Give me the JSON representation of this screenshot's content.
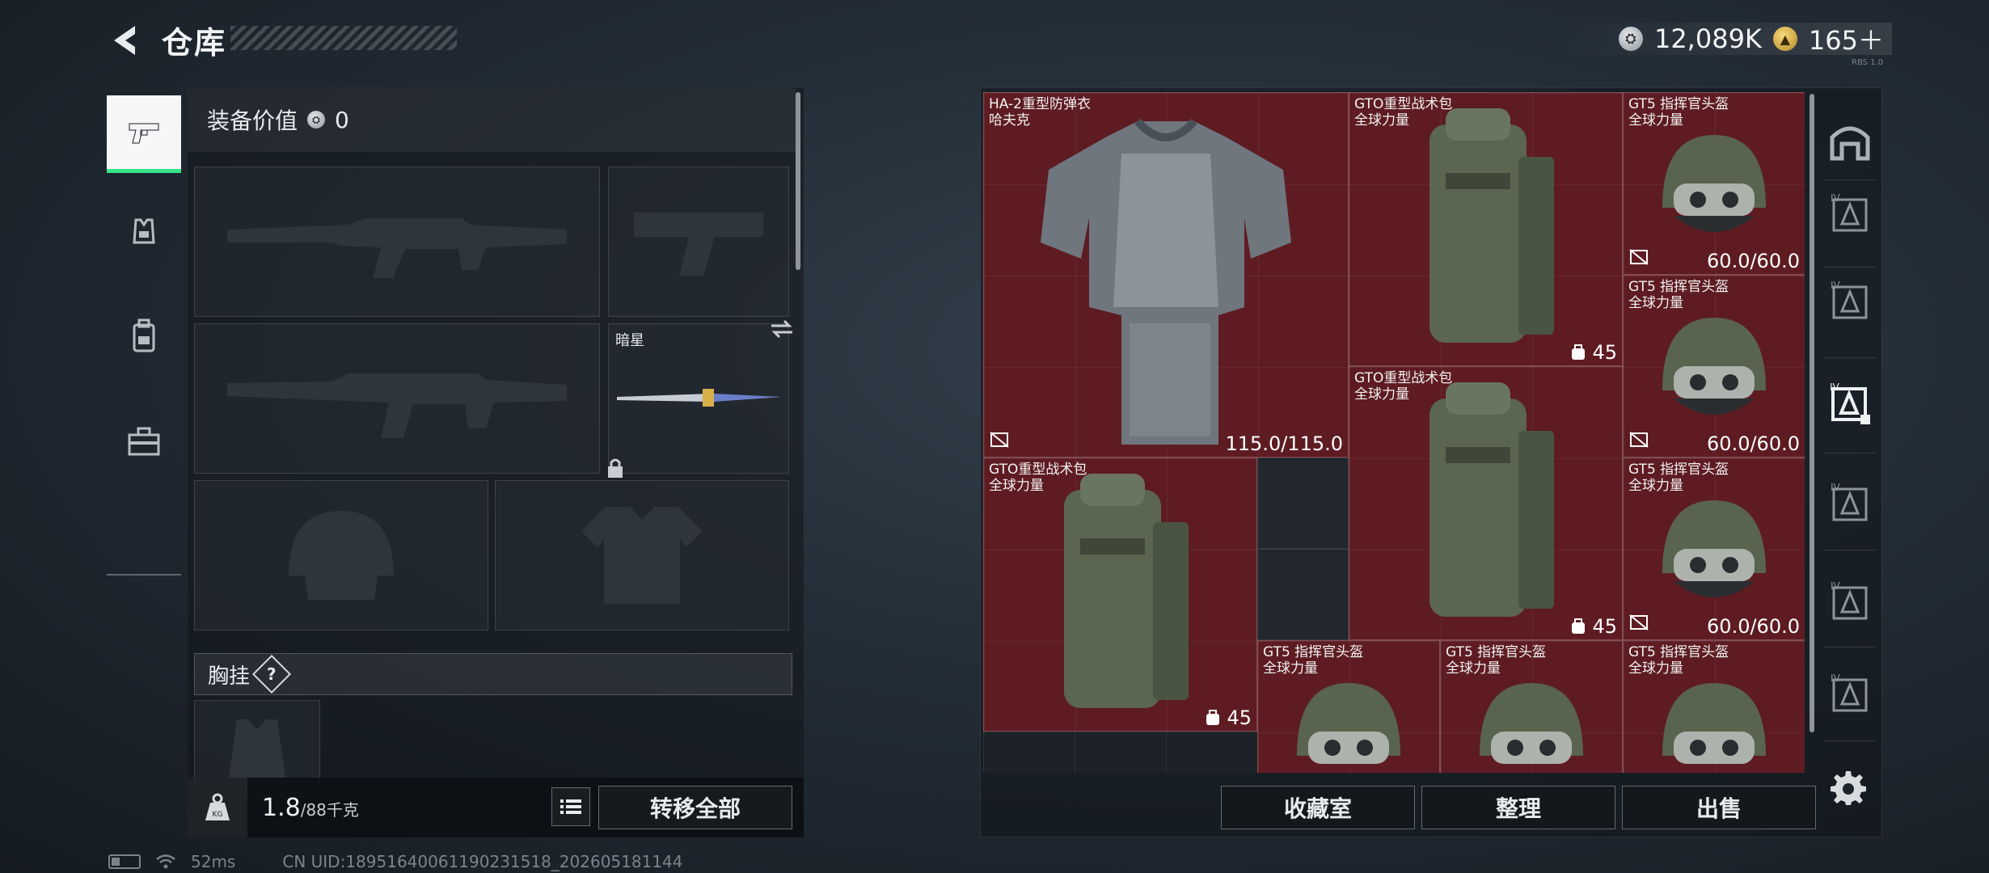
{
  "header": {
    "title": "仓库",
    "currency": [
      {
        "icon": "silver-coin-icon",
        "value": "12,089K"
      },
      {
        "icon": "gold-coin-icon",
        "value": "165＋"
      }
    ],
    "tag": "RBS 1.0"
  },
  "sidebar": {
    "tabs": [
      {
        "name": "weapons",
        "icon": "pistol-icon",
        "active": true
      },
      {
        "name": "rig",
        "icon": "rig-icon",
        "active": false
      },
      {
        "name": "backpack",
        "icon": "backpack-icon",
        "active": false
      },
      {
        "name": "supplies",
        "icon": "toolbox-icon",
        "active": false
      }
    ]
  },
  "equipment": {
    "value_label": "装备价值",
    "value": "0",
    "knife_name": "暗星",
    "chest_label": "胸挂",
    "help_mark": "?"
  },
  "weight": {
    "current": "1.8",
    "max": "/88千克",
    "transfer_all": "转移全部"
  },
  "storage": {
    "items": [
      {
        "name": "HA-2重型防弹衣",
        "brand": "哈夫克",
        "durability": "115.0/115.0",
        "type": "armor"
      },
      {
        "name": "GTO重型战术包",
        "brand": "全球力量",
        "capacity": "45",
        "type": "backpack"
      },
      {
        "name": "GT5 指挥官头盔",
        "brand": "全球力量",
        "durability": "60.0/60.0",
        "type": "helmet"
      },
      {
        "name": "GT5 指挥官头盔",
        "brand": "全球力量",
        "durability": "60.0/60.0",
        "type": "helmet"
      },
      {
        "name": "GTO重型战术包",
        "brand": "全球力量",
        "capacity": "45",
        "type": "backpack"
      },
      {
        "name": "GTO重型战术包",
        "brand": "全球力量",
        "capacity": "45",
        "type": "backpack"
      },
      {
        "name": "GT5 指挥官头盔",
        "brand": "全球力量",
        "durability": "60.0/60.0",
        "type": "helmet"
      },
      {
        "name": "GT5 指挥官头盔",
        "brand": "全球力量",
        "type": "helmet"
      },
      {
        "name": "GT5 指挥官头盔",
        "brand": "全球力量",
        "type": "helmet"
      },
      {
        "name": "GT5 指挥官头盔",
        "brand": "全球力量",
        "type": "helmet"
      }
    ],
    "rail_labels": [
      "IV",
      "IV",
      "IV",
      "IV",
      "IV",
      "IV"
    ]
  },
  "actions": {
    "collection": "收藏室",
    "organize": "整理",
    "sell": "出售"
  },
  "status": {
    "ping": "52ms",
    "uid": "CN UID:18951640061190231518_202605181144"
  },
  "colors": {
    "accent_green": "#36e48a",
    "item_red": "#5e1c22"
  }
}
